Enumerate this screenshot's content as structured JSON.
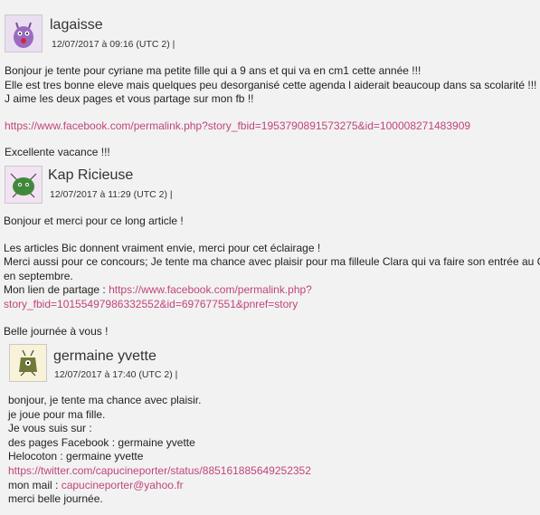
{
  "comments": [
    {
      "author": "lagaisse",
      "date": "12/07/2017 à 09:16 (UTC 2) |",
      "paragraphs": [
        {
          "lines": [
            "Bonjour je tente pour cyriane ma petite fille qui a 9 ans et qui va en cm1 cette année !!!",
            "Elle est tres bonne eleve mais quelques peu desorganisé cette agenda l aiderait beaucoup dans sa scolarité !!!",
            "J aime les deux pages et vous partage sur mon fb !!"
          ]
        },
        {
          "link": "https://www.facebook.com/permalink.php?story_fbid=1953790891573275&id=100008271483909"
        },
        {
          "lines": [
            "Excellente vacance !!!"
          ]
        }
      ]
    },
    {
      "author": "Kap Ricieuse",
      "date": "12/07/2017 à 11:29 (UTC 2) |",
      "p1": "Bonjour et merci pour ce long article !",
      "p2_lines": [
        "Les articles Bic donnent vraiment envie, merci pour cet éclairage !",
        "Merci aussi pour ce concours; Je tente ma chance avec plaisir pour ma filleule Clara qui va faire son entrée au CP",
        "en septembre."
      ],
      "partage_label": "Mon lien de partage : ",
      "partage_link_1": "https://www.facebook.com/permalink.php?",
      "partage_link_2": "story_fbid=10155497986332552&id=697677551&pnref=story",
      "p3": "Belle journée à vous !"
    },
    {
      "author": "germaine yvette",
      "date": "12/07/2017 à 17:40 (UTC 2) |",
      "lines_before": [
        "bonjour, je tente ma chance avec plaisir.",
        "je joue pour ma fille.",
        "Je vous suis sur :",
        "des pages Facebook : germaine yvette",
        "Helocoton : germaine yvette"
      ],
      "twitter_link": "https://twitter.com/capucineporter/status/885161885649252352",
      "mail_label": "mon mail : ",
      "mail_link": "capucineporter@yahoo.fr",
      "closing": "merci belle journée."
    }
  ],
  "colors": {
    "link": "#c0457a",
    "background": "#f2f2f2"
  }
}
